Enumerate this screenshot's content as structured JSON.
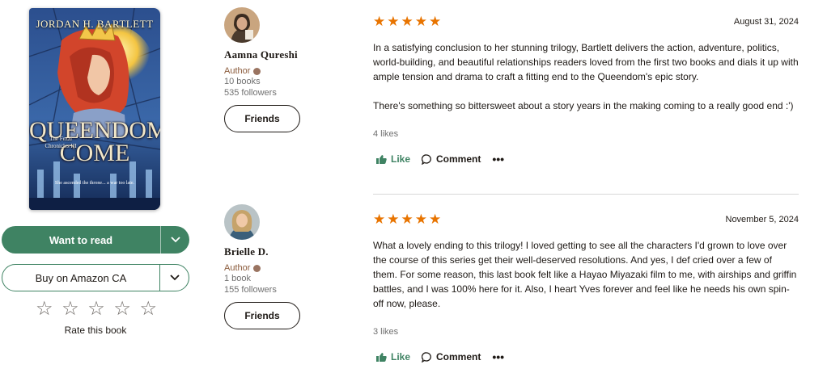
{
  "book": {
    "cover_author": "JORDAN H. BARTLETT",
    "cover_title_line1": "QUEENDOM",
    "cover_title_line2": "COME",
    "cover_series": "The Fezzi Chronicles III",
    "cover_tagline": "She ascended the throne... a war too late."
  },
  "shelf": {
    "want_to_read": "Want to read",
    "buy_label": "Buy on Amazon CA",
    "rate_label": "Rate this book",
    "star_glyph": "☆"
  },
  "reviews": [
    {
      "reviewer": {
        "name": "Aamna Qureshi",
        "badge": "Author",
        "books": "10 books",
        "followers": "535 followers",
        "friends_label": "Friends"
      },
      "rating": 5,
      "date": "August 31, 2024",
      "paragraphs": [
        "In a satisfying conclusion to her stunning trilogy, Bartlett delivers the action, adventure, politics, world-building, and beautiful relationships readers loved from the first two books and dials it up with ample tension and drama to craft a fitting end to the Queendom's epic story.",
        "There's something so bittersweet about a story years in the making coming to a really good end :')"
      ],
      "likes": "4 likes",
      "like_label": "Like",
      "comment_label": "Comment",
      "more_label": "•••"
    },
    {
      "reviewer": {
        "name": "Brielle D.",
        "badge": "Author",
        "books": "1 book",
        "followers": "155 followers",
        "friends_label": "Friends"
      },
      "rating": 5,
      "date": "November 5, 2024",
      "paragraphs": [
        "What a lovely ending to this trilogy! I loved getting to see all the characters I'd grown to love over the course of this series get their well-deserved resolutions. And yes, I def cried over a few of them. For some reason, this last book felt like a Hayao Miyazaki film to me, with airships and griffin battles, and I was 100% here for it. Also, I heart Yves forever and feel like he needs his own spin-off now, please."
      ],
      "likes": "3 likes",
      "like_label": "Like",
      "comment_label": "Comment",
      "more_label": "•••"
    }
  ],
  "colors": {
    "accent_green": "#3f8363",
    "star_orange": "#e87400",
    "author_brown": "#8a5a3a"
  }
}
